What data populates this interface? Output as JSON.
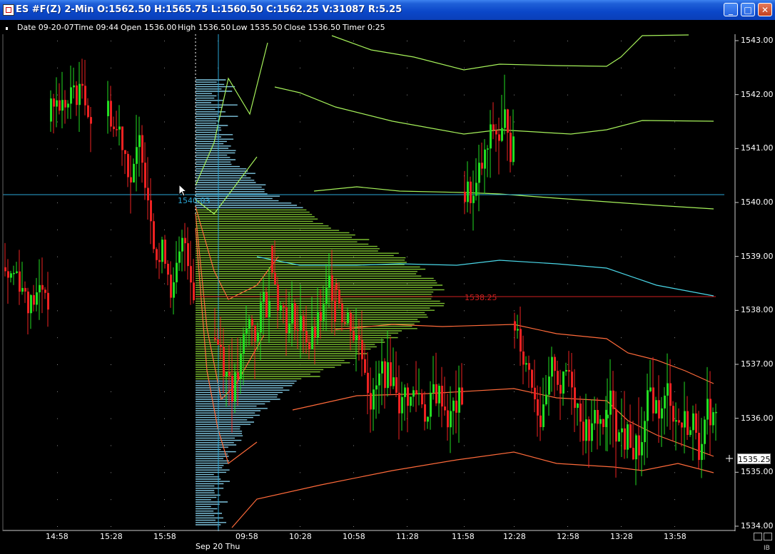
{
  "window": {
    "title": "ES #F(Z) 2-Min O:1562.50 H:1565.75 L:1560.50 C:1562.25 V:31087 R:5.25",
    "min_icon": "minimize-icon",
    "max_icon": "maximize-icon",
    "close_icon": "close-icon"
  },
  "infobar": {
    "date": "Date 09-20-07",
    "time": "Time 09:44",
    "open": "Open 1536.00",
    "high": "High 1536.50",
    "low": "Low 1535.50",
    "close": "Close 1536.50",
    "timer": "Timer 0:25"
  },
  "price_axis": [
    "1543.00",
    "1542.00",
    "1541.00",
    "1540.00",
    "1539.00",
    "1538.00",
    "1537.00",
    "1536.00",
    "1535.00",
    "1534.00"
  ],
  "time_axis": [
    "14:58",
    "15:28",
    "15:58",
    "09:58",
    "10:28",
    "10:58",
    "11:28",
    "11:58",
    "12:28",
    "12:58",
    "13:28",
    "13:58"
  ],
  "date_label": "Sep 20 Thu",
  "last_price": "1535.25",
  "vwap_label": "1538.25",
  "crosshair_label": "1540.03",
  "ib_label": "IB",
  "chart_data": {
    "type": "candlestick",
    "symbol": "ES #F(Z)",
    "interval": "2-Min",
    "ylim": [
      1534.0,
      1543.0
    ],
    "x_ticks": [
      "14:58",
      "15:28",
      "15:58",
      "09:58",
      "10:28",
      "10:58",
      "11:28",
      "11:58",
      "12:28",
      "12:58",
      "13:28",
      "13:58"
    ],
    "session_break": "Sep 20 Thu",
    "last": 1535.25,
    "vwap": 1538.25,
    "crosshair": 1540.03,
    "colors": {
      "up": "#22dd22",
      "down": "#ee2222",
      "profile_upper": "#7fc6e0",
      "profile_value": "#7cc030",
      "bands_upper": "#a6f25a",
      "bands_lower": "#ff6a3a",
      "vwap_line": "#4ad7e8"
    }
  }
}
